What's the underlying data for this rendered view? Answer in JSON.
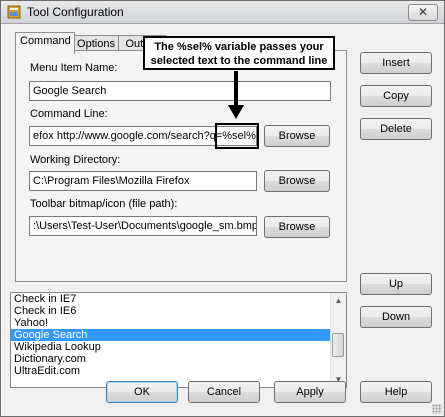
{
  "window": {
    "title": "Tool Configuration",
    "close_label": "✕"
  },
  "tabs": [
    {
      "label": "Command"
    },
    {
      "label": "Options"
    },
    {
      "label": "Output"
    }
  ],
  "form": {
    "menu_item_label": "Menu Item Name:",
    "menu_item_value": "Google Search",
    "command_line_label": "Command Line:",
    "command_line_value": "efox http://www.google.com/search?q=%sel%",
    "working_dir_label": "Working Directory:",
    "working_dir_value": "C:\\Program Files\\Mozilla Firefox",
    "toolbar_icon_label": "Toolbar bitmap/icon (file path):",
    "toolbar_icon_value": ":\\Users\\Test-User\\Documents\\google_sm.bmp",
    "browse_label": "Browse"
  },
  "callout": {
    "line1": "The %sel% variable passes your",
    "line2": "selected text to the command line"
  },
  "side_buttons": {
    "insert": "Insert",
    "copy": "Copy",
    "delete": "Delete",
    "up": "Up",
    "down": "Down"
  },
  "tool_list": {
    "items": [
      {
        "label": "Check in IE7"
      },
      {
        "label": "Check in IE6"
      },
      {
        "label": "Yahoo!"
      },
      {
        "label": "Google Search"
      },
      {
        "label": "Wikipedia Lookup"
      },
      {
        "label": "Dictionary.com"
      },
      {
        "label": "UltraEdit.com"
      }
    ],
    "selected": "Google Search"
  },
  "footer": {
    "ok": "OK",
    "cancel": "Cancel",
    "apply": "Apply",
    "help": "Help"
  },
  "colors": {
    "selection": "#3399ff",
    "face": "#f0f0f0"
  }
}
